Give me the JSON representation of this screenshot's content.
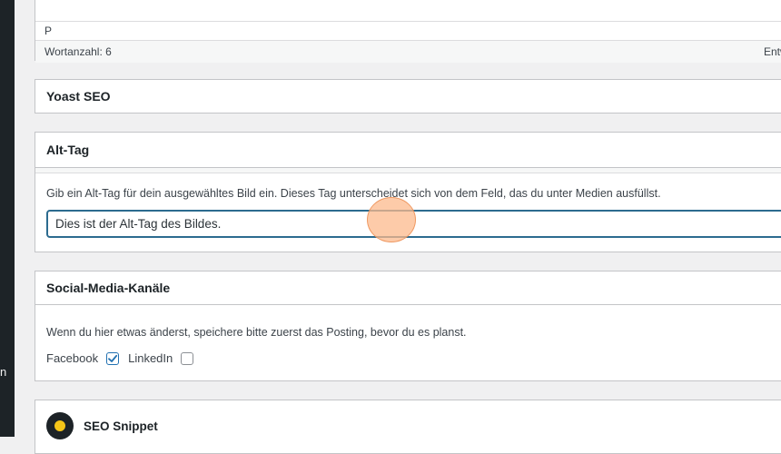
{
  "sidebar": {
    "fragment_text": "n"
  },
  "editor": {
    "path_label": "P",
    "word_count": "Wortanzahl: 6",
    "status_right": "Entw"
  },
  "yoast": {
    "title": "Yoast SEO"
  },
  "alt_tag": {
    "title": "Alt-Tag",
    "description": "Gib ein Alt-Tag für dein ausgewähltes Bild ein. Dieses Tag unterscheidet sich von dem Feld, das du unter Medien ausfüllst.",
    "input_value": "Dies ist der Alt-Tag des Bildes."
  },
  "social": {
    "title": "Social-Media-Kanäle",
    "description": "Wenn du hier etwas änderst, speichere bitte zuerst das Posting, bevor du es planst.",
    "channels": [
      {
        "label": "Facebook",
        "checked": true
      },
      {
        "label": "LinkedIn",
        "checked": false
      }
    ]
  },
  "seo_snippet": {
    "title": "SEO Snippet",
    "logo_icon": "seo-snippet-logo-icon"
  },
  "colors": {
    "accent": "#2271b1",
    "input_border": "#2c6b8f",
    "click_marker": "#fcba8c"
  }
}
